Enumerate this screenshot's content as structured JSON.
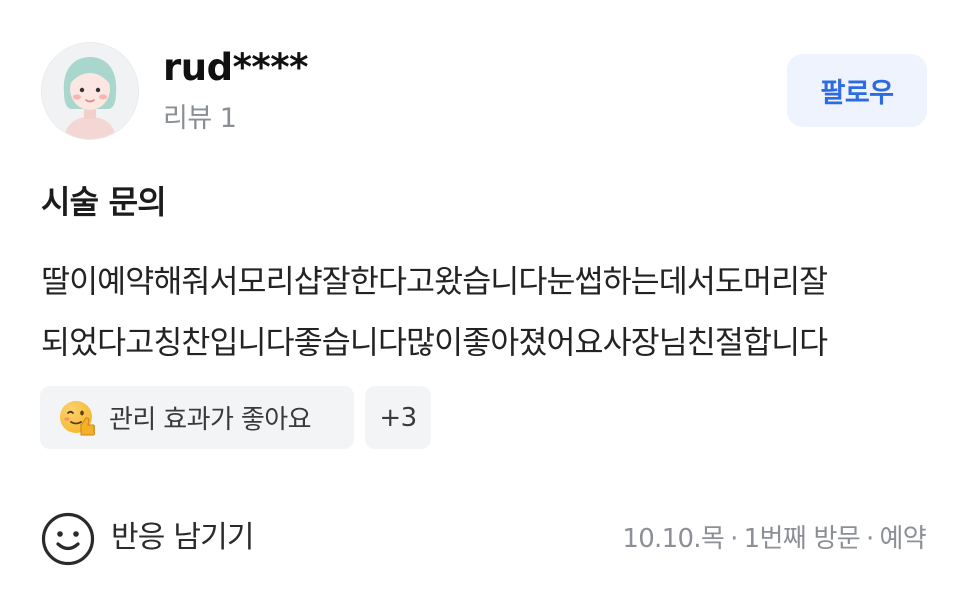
{
  "reviewer": {
    "avatar_icon": "avatar-icon",
    "username": "rud****",
    "review_count_label": "리뷰 1",
    "follow_label": "팔로우"
  },
  "review": {
    "title": "시술 문의",
    "body": "딸이예약해줘서모리샵잘한다고왔습니다눈썹하는데서도머리잘\n되었다고칭찬입니다좋습니다많이좋아졌어요사장님친절합니다",
    "keywords": {
      "first_icon": "thumbs-up-smile-emoji",
      "first_label": "관리 효과가 좋아요",
      "more_label": "+3"
    }
  },
  "footer": {
    "reaction_icon": "smiley-icon",
    "reaction_label": "반응 남기기",
    "date": "10.10.목",
    "visit": "1번째 방문",
    "booking": "예약",
    "separator": "·"
  },
  "colors": {
    "accent": "#2d6be4",
    "follow_bg": "#eef3fd",
    "chip_bg": "#f3f4f6",
    "muted_text": "#8a8f95"
  }
}
